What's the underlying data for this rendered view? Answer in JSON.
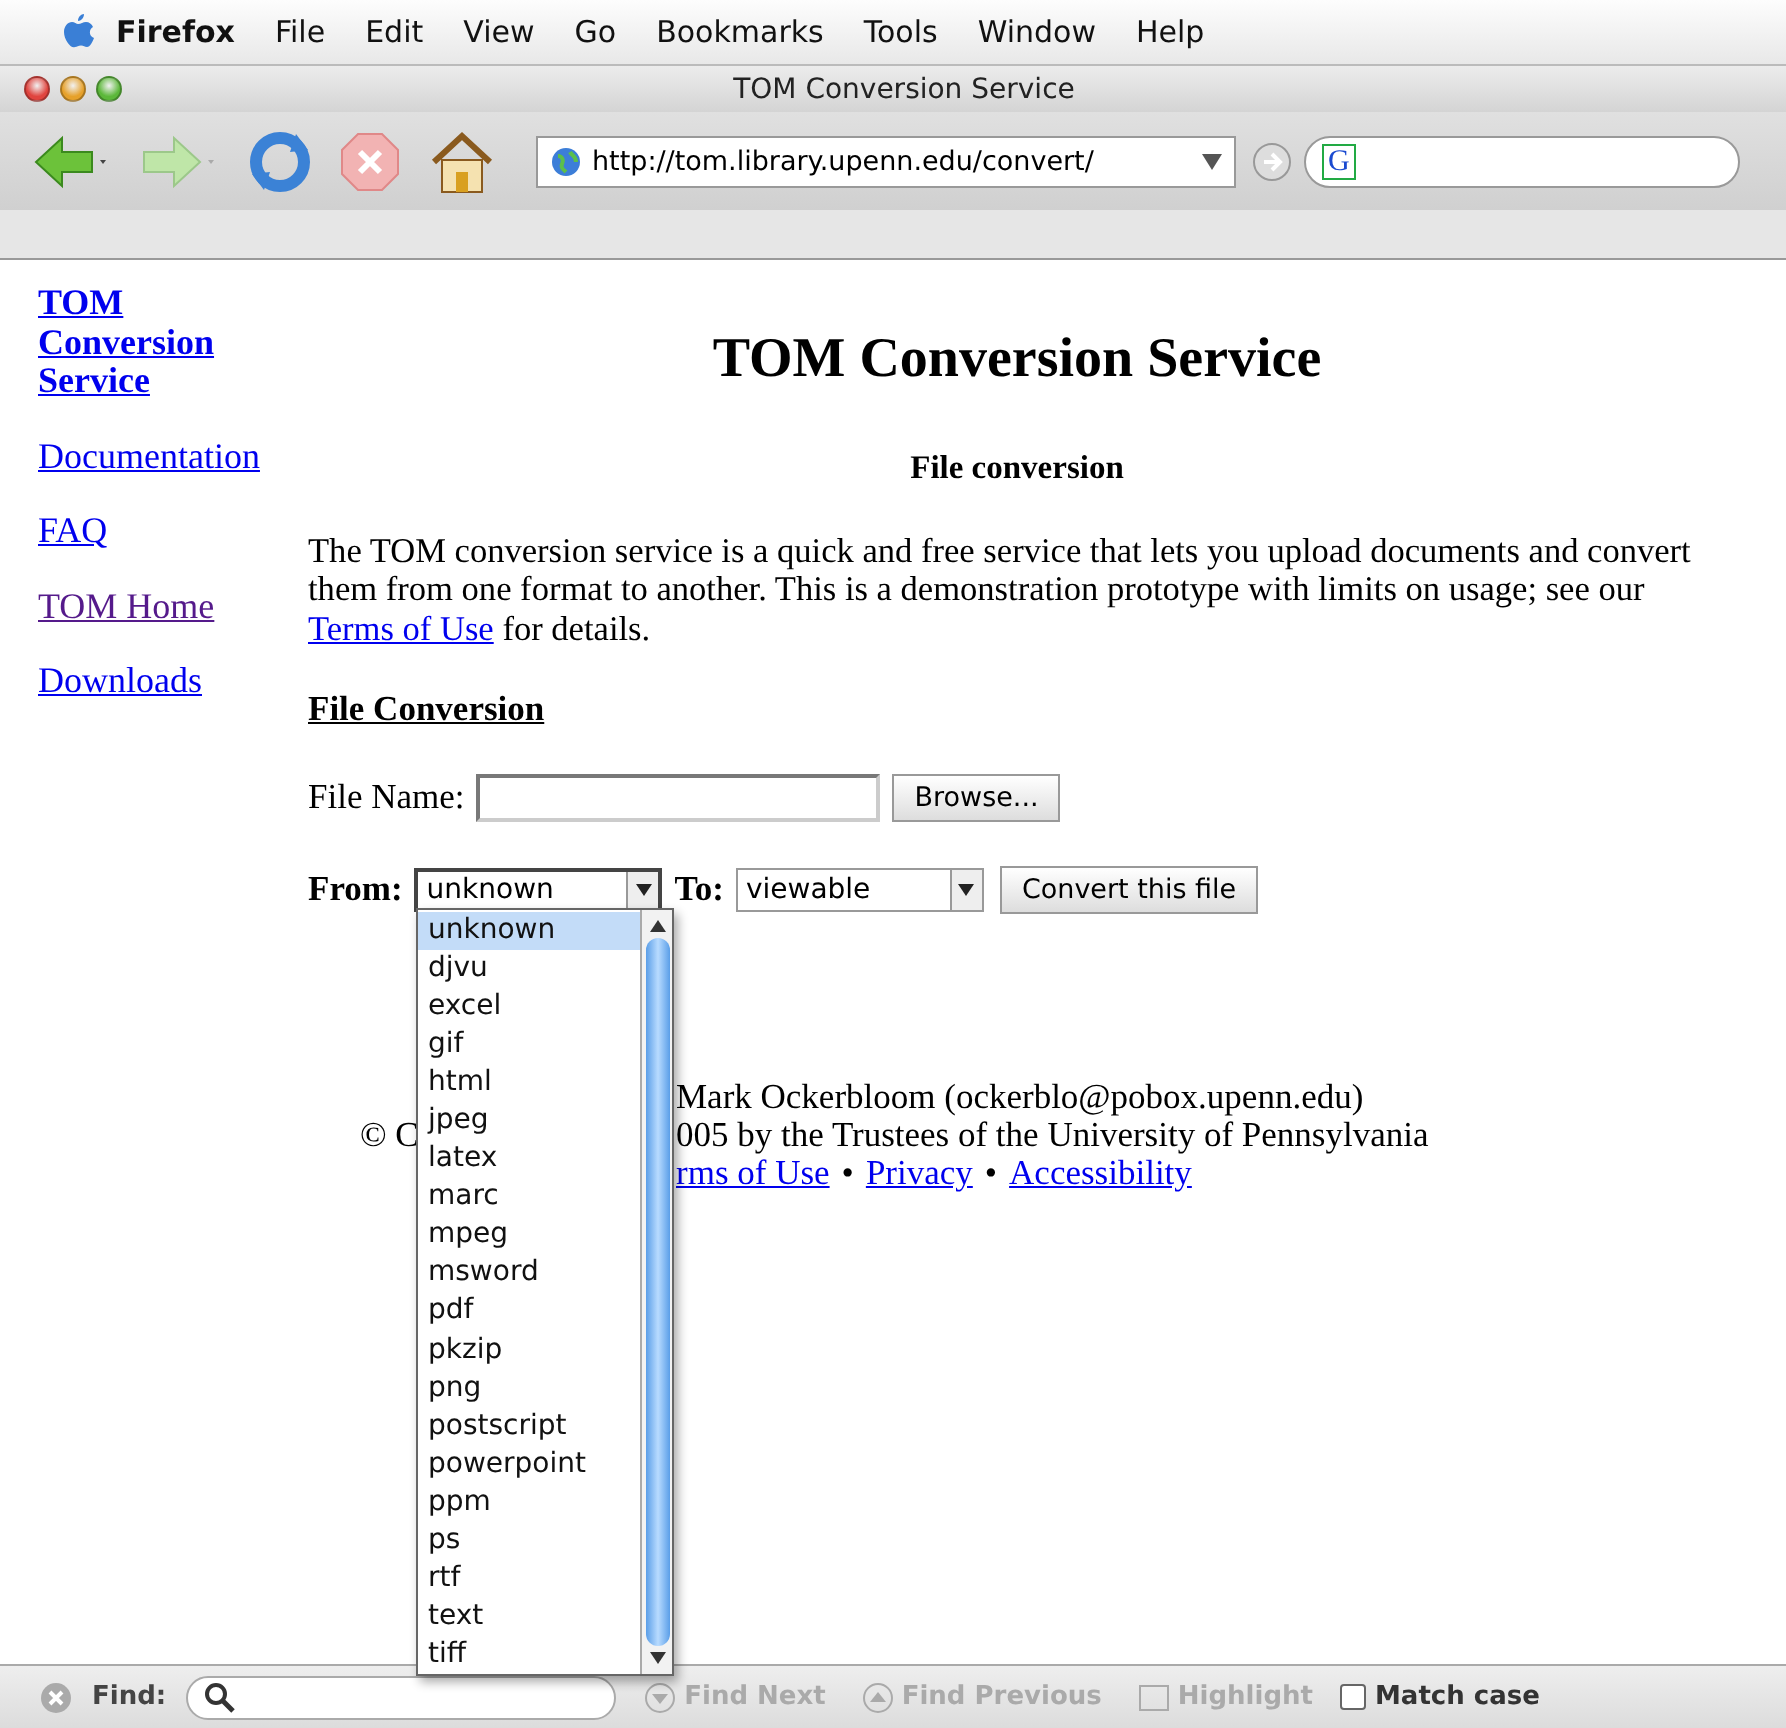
{
  "menubar": {
    "app": "Firefox",
    "items": [
      "File",
      "Edit",
      "View",
      "Go",
      "Bookmarks",
      "Tools",
      "Window",
      "Help"
    ]
  },
  "window": {
    "title": "TOM Conversion Service"
  },
  "toolbar": {
    "url": "http://tom.library.upenn.edu/convert/",
    "search_engine": "G"
  },
  "sidebar": {
    "links": [
      {
        "label": "TOM Conversion Service",
        "kind": "title",
        "visited": false
      },
      {
        "label": "Documentation",
        "kind": "link",
        "visited": false
      },
      {
        "label": "FAQ",
        "kind": "link",
        "visited": false
      },
      {
        "label": "TOM Home",
        "kind": "link",
        "visited": true
      },
      {
        "label": "Downloads",
        "kind": "link",
        "visited": false
      }
    ]
  },
  "page": {
    "heading": "TOM Conversion Service",
    "subheading": "File conversion",
    "intro_before": "The TOM conversion service is a quick and free service that lets you upload documents and convert them from one format to another. This is a demonstration prototype with limits on usage; see our",
    "intro_link": "Terms of Use",
    "intro_after": "for details.",
    "section_title": "File Conversion",
    "file_name_label": "File Name:",
    "browse_button": "Browse...",
    "from_label": "From:",
    "from_value": "unknown",
    "to_label": "To:",
    "to_value": "viewable",
    "convert_button": "Convert this file"
  },
  "dropdown": {
    "options": [
      {
        "label": "unknown",
        "selected": true
      },
      {
        "label": "djvu",
        "selected": false
      },
      {
        "label": "excel",
        "selected": false
      },
      {
        "label": "gif",
        "selected": false
      },
      {
        "label": "html",
        "selected": false
      },
      {
        "label": "jpeg",
        "selected": false
      },
      {
        "label": "latex",
        "selected": false
      },
      {
        "label": "marc",
        "selected": false
      },
      {
        "label": "mpeg",
        "selected": false
      },
      {
        "label": "msword",
        "selected": false
      },
      {
        "label": "pdf",
        "selected": false
      },
      {
        "label": "pkzip",
        "selected": false
      },
      {
        "label": "png",
        "selected": false
      },
      {
        "label": "postscript",
        "selected": false
      },
      {
        "label": "powerpoint",
        "selected": false
      },
      {
        "label": "ppm",
        "selected": false
      },
      {
        "label": "ps",
        "selected": false
      },
      {
        "label": "rtf",
        "selected": false
      },
      {
        "label": "text",
        "selected": false
      },
      {
        "label": "tiff",
        "selected": false
      }
    ]
  },
  "footer": {
    "line_1": "Mark Ockerbloom (ockerblo@pobox.upenn.edu)",
    "line_2_start": "© C",
    "line_2_rest": "005 by the Trustees of the University of Pennsylvania",
    "separator": "•",
    "links": [
      "rms of Use",
      "Privacy",
      "Accessibility"
    ]
  },
  "find_bar": {
    "label": "Find:",
    "buttons": [
      {
        "label": "Find Next",
        "disabled": true
      },
      {
        "label": "Find Previous",
        "disabled": true
      },
      {
        "label": "Highlight",
        "disabled": true
      }
    ],
    "match_case": {
      "label": "Match case",
      "checked": false
    }
  }
}
